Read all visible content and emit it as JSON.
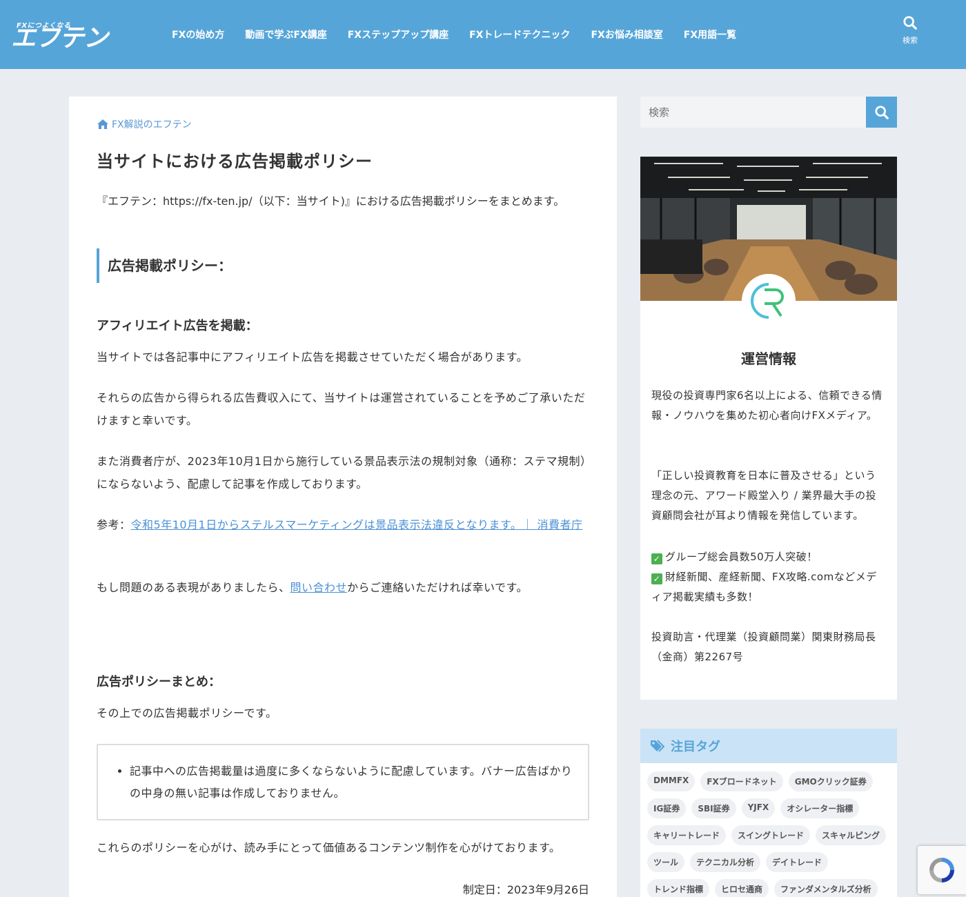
{
  "header": {
    "logo_tagline": "FXにつよくなる",
    "logo_text": "エフテン",
    "nav": [
      "FXの始め方",
      "動画で学ぶFX講座",
      "FXステップアップ講座",
      "FXトレードテクニック",
      "FXお悩み相談室",
      "FX用語一覧"
    ],
    "search_label": "検索"
  },
  "article": {
    "breadcrumb": "FX解説のエフテン",
    "title": "当サイトにおける広告掲載ポリシー",
    "intro": "『エフテン：https://fx-ten.jp/（以下：当サイト)』における広告掲載ポリシーをまとめます。",
    "h2": "広告掲載ポリシー：",
    "h3_affiliate": "アフィリエイト広告を掲載：",
    "p1": "当サイトでは各記事中にアフィリエイト広告を掲載させていただく場合があります。",
    "p2": "それらの広告から得られる広告費収入にて、当サイトは運営されていることを予めご了承いただけますと幸いです。",
    "p3": "また消費者庁が、2023年10月1日から施行している景品表示法の規制対象（通称：ステマ規制）にならないよう、配慮して記事を作成しております。",
    "ref_prefix": "参考：",
    "ref_link": "令和5年10月1日からステルスマーケティングは景品表示法違反となります。｜ 消費者庁",
    "p4_before": "もし問題のある表現がありましたら、",
    "p4_link": "問い合わせ",
    "p4_after": "からご連絡いただければ幸いです。",
    "h3_summary": "広告ポリシーまとめ：",
    "p5": "その上での広告掲載ポリシーです。",
    "box_item": "記事中への広告掲載量は過度に多くならないように配慮しています。バナー広告ばかりの中身の無い記事は作成しておりません。",
    "p6": "これらのポリシーを心がけ、読み手にとって価値あるコンテンツ制作を心がけております。",
    "date": "制定日：2023年9月26日"
  },
  "sidebar": {
    "search_placeholder": "検索",
    "profile": {
      "name": "運営情報",
      "desc1": "現役の投資専門家6名以上による、信頼できる情報・ノウハウを集めた初心者向けFXメディア。",
      "desc2": "「正しい投資教育を日本に普及させる」という理念の元、アワード殿堂入り / 業界最大手の投資顧問会社が耳より情報を発信しています。",
      "check1": "グループ総会員数50万人突破！",
      "check2": "財経新聞、産経新聞、FX攻略.comなどメディア掲載実績も多数！",
      "license": "投資助言・代理業（投資顧問業）関東財務局長（金商）第2267号"
    },
    "tags_title": "注目タグ",
    "tags": [
      "DMMFX",
      "FXブロードネット",
      "GMOクリック証券",
      "IG証券",
      "SBI証券",
      "YJFX",
      "オシレーター指標",
      "キャリートレード",
      "スイングトレード",
      "スキャルピング",
      "ツール",
      "テクニカル分析",
      "デイトレード",
      "トレンド指標",
      "ヒロセ通商",
      "ファンダメンタルズ分析"
    ]
  },
  "colors": {
    "header_bg": "#56a5d8",
    "link": "#4a90d6",
    "page_bg": "#e9ecf0"
  }
}
